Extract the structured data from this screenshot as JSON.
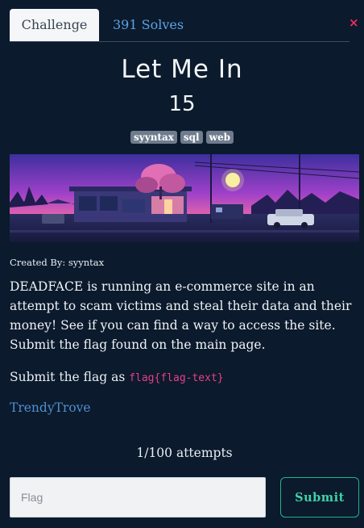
{
  "tabs": {
    "challenge_label": "Challenge",
    "solves_label": "391 Solves"
  },
  "close_glyph": "×",
  "challenge": {
    "title": "Let Me In",
    "points": "15",
    "tags": [
      "syyntax",
      "sql",
      "web"
    ],
    "created_by": "Created By: syyntax",
    "description": "DEADFACE is running an e-commerce site in an attempt to scam victims and steal their data and their money! See if you can find a way to access the site. Submit the flag found on the main page.",
    "submit_prefix": "Submit the flag as ",
    "flag_format": "flag{flag-text}",
    "link_text": "TrendyTrove"
  },
  "attempts": "1/100 attempts",
  "form": {
    "flag_placeholder": "Flag",
    "flag_value": "",
    "submit_label": "Submit"
  },
  "colors": {
    "background": "#0b1a2c",
    "link": "#4f8fd0",
    "code": "#e83e8c",
    "submit_accent": "#1fb38a",
    "close": "#e8305c"
  }
}
